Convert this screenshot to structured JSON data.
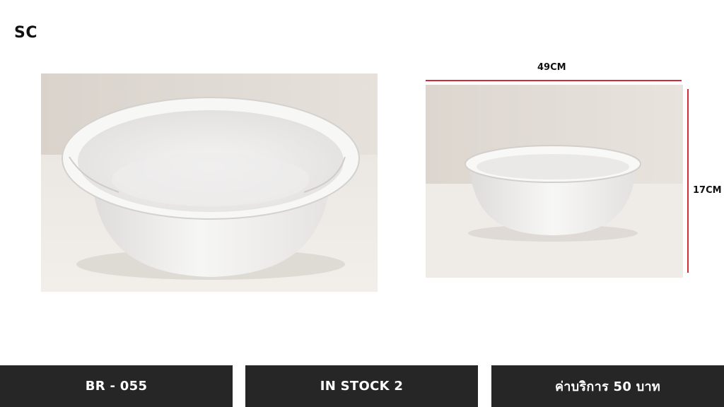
{
  "brand": "SC",
  "dimensions": {
    "width_label": "49CM",
    "height_label": "17CM",
    "line_color": "#d32a3c"
  },
  "info_bar": {
    "product_code": "BR - 055",
    "stock": "IN STOCK 2",
    "service_fee": "ค่าบริการ 50 บาท",
    "background": "#262626"
  },
  "images": {
    "left": "white-basin-photo",
    "right": "white-basin-photo-small"
  }
}
